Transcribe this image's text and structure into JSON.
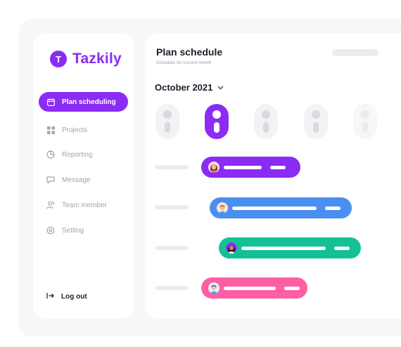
{
  "app": {
    "name": "Tazkily",
    "logo_letter": "T",
    "accent": "#8b2cf5"
  },
  "sidebar": {
    "items": [
      {
        "label": "Plan scheduling",
        "icon": "calendar-icon",
        "active": true
      },
      {
        "label": "Projects",
        "icon": "grid-icon",
        "active": false
      },
      {
        "label": "Reporting",
        "icon": "pie-chart-icon",
        "active": false
      },
      {
        "label": "Message",
        "icon": "chat-icon",
        "active": false
      },
      {
        "label": "Team member",
        "icon": "users-icon",
        "active": false
      },
      {
        "label": "Setting",
        "icon": "gear-icon",
        "active": false
      }
    ],
    "logout_label": "Log out"
  },
  "header": {
    "title": "Plan schedule",
    "subtitle": "Schedule for current month",
    "month": "October 2021"
  },
  "days": [
    {
      "state": "inactive"
    },
    {
      "state": "active"
    },
    {
      "state": "inactive"
    },
    {
      "state": "inactive"
    },
    {
      "state": "faded"
    }
  ],
  "tasks": [
    {
      "color": "#8b2cf5"
    },
    {
      "color": "#4a8ff0"
    },
    {
      "color": "#12c295"
    },
    {
      "color": "#ff5fa2"
    }
  ]
}
